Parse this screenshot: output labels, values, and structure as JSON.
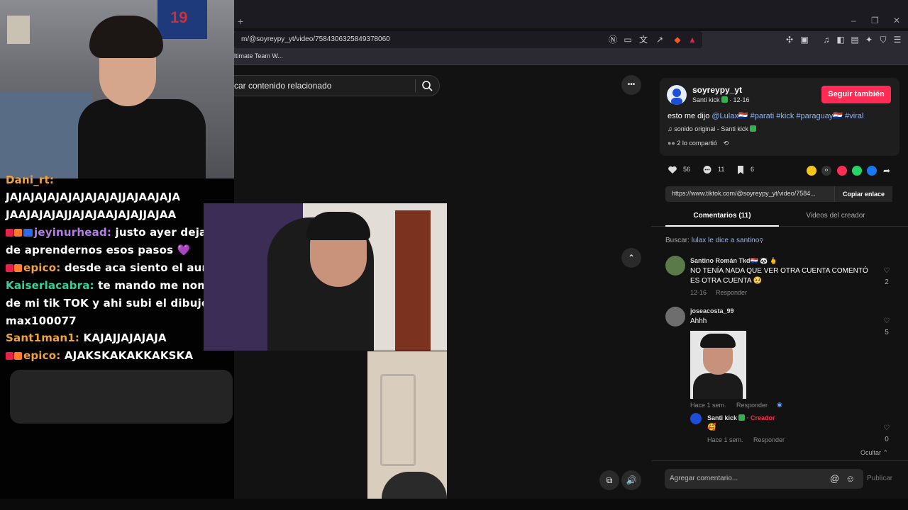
{
  "browser": {
    "new_tab": "+",
    "window_controls": {
      "minimize": "–",
      "restore": "❐",
      "close": "✕"
    },
    "url": "m/@soyreypy_yt/video/7584306325849378060",
    "bookmark": "ltimate Team W..."
  },
  "search": {
    "placeholder": "car contenido relacionado"
  },
  "webcam": {
    "jersey_number": "19"
  },
  "chat": {
    "lines": [
      {
        "user": "Dani_rt:",
        "text": ""
      },
      {
        "user": "",
        "text": "JAJAJAJAJAJAJAJAJAJJAJAAJAJA"
      },
      {
        "user": "",
        "text": "JAAJAJAJAJJAJAJAAJAJAJJAJAA"
      },
      {
        "user": "jeyinurhead:",
        "text": " justo ayer dejamos"
      },
      {
        "user": "",
        "text": "de aprendernos esos pasos ",
        "heart": "💜"
      },
      {
        "user": "epico:",
        "text": " desde aca siento el aura"
      },
      {
        "user": "Kaiserlacabra:",
        "text": " te mando me nombre"
      },
      {
        "user": "",
        "text": "de mi tik TOK y ahi subi el dibujo :user"
      },
      {
        "user": "",
        "text": "max100077"
      },
      {
        "user": "Sant1man1:",
        "text": " KAJAJJAJAJAJA"
      },
      {
        "user": "epico:",
        "text": " AJAKSKAKAKKAKSKA"
      }
    ],
    "colors": {
      "dani": "#f2a33b",
      "jeyin": "#b47fe6",
      "epico": "#f2a33b",
      "kaiser": "#34d399",
      "santiman": "#f2a33b"
    }
  },
  "video_controls": {
    "more": "•••",
    "up": "⌃",
    "pip": "⧉",
    "volume": "🔊"
  },
  "post": {
    "creator": "soyreypy_yt",
    "creator_sub": "Santi kick",
    "date": "· 12-16",
    "follow_label": "Seguir también",
    "desc_prefix": "esto me dijo ",
    "desc_tags": "@Lulax🇵🇾 #parati #kick #paraguay🇵🇾 #viral",
    "sound": "sonido original - Santi kick",
    "shared": "2 lo compartió",
    "likes": "56",
    "comments": "11",
    "saves": "6",
    "link": "https://www.tiktok.com/@soyreypy_yt/video/7584...",
    "copy_label": "Copiar enlace",
    "tabs": [
      "Comentarios (11)",
      "Videos del creador"
    ],
    "search_label": "Buscar:",
    "search_link": "lulax le dice a santino"
  },
  "comments": [
    {
      "user": "Santino Román Tkd🇵🇾 🐼 🖕",
      "text": "NO TENÍA NADA QUE VER OTRA CUENTA COMENTÓ ES OTRA CUENTA 🥺",
      "meta_date": "12-16",
      "reply": "Responder",
      "likes": "2"
    },
    {
      "user": "joseacosta_99",
      "text": "Ahhh",
      "meta_date": "Hace 1 sem.",
      "reply": "Responder",
      "likes": "5"
    },
    {
      "user": "Santi kick",
      "creator_tag": "· Creador",
      "text": "🥰",
      "meta_date": "Hace 1 sem.",
      "reply": "Responder",
      "likes": "0"
    }
  ],
  "hide_label": "Ocultar ⌃",
  "comment_bar": {
    "placeholder": "Agregar comentario...",
    "at": "@",
    "emoji": "☺",
    "publish": "Publicar"
  },
  "colors": {
    "accent": "#fe2c55",
    "tag": "#8ab4f8",
    "verified": "#31b24b"
  }
}
